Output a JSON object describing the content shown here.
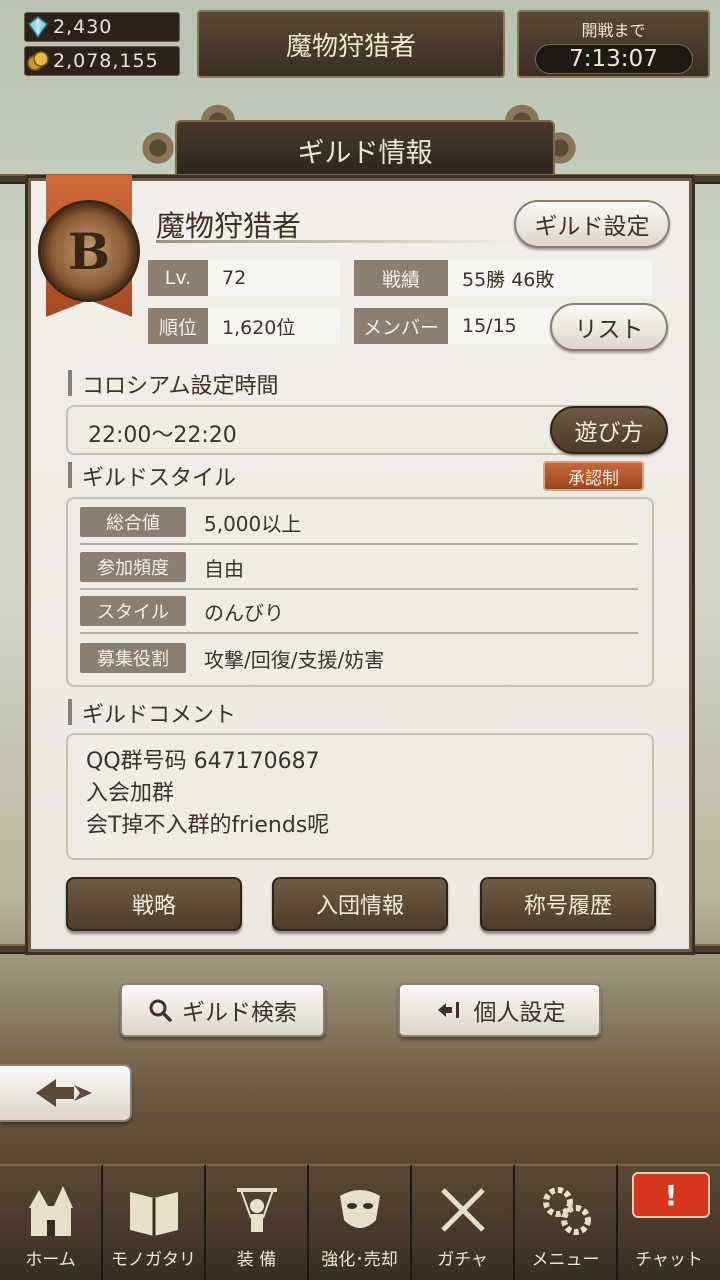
{
  "currency": {
    "gems": "2,430",
    "coins": "2,078,155"
  },
  "header": {
    "guild_title": "魔物狩猎者",
    "timer_label": "開戦まで",
    "timer_value": "7:13:07"
  },
  "panel": {
    "title": "ギルド情報"
  },
  "guild": {
    "rank": "B",
    "name": "魔物狩猎者",
    "settings_button": "ギルド設定",
    "level_label": "Lv.",
    "level_value": "72",
    "record_label": "戦績",
    "record_value": "55勝 46敗",
    "rank_label": "順位",
    "rank_value": "1,620位",
    "members_label": "メンバー",
    "members_value": "15/15",
    "list_button": "リスト"
  },
  "colosseum": {
    "title": "コロシアム設定時間",
    "time": "22:00〜22:20",
    "howto_button": "遊び方"
  },
  "style": {
    "title": "ギルドスタイル",
    "approval": "承認制",
    "rows": [
      {
        "label": "総合値",
        "value": "5,000以上"
      },
      {
        "label": "参加頻度",
        "value": "自由"
      },
      {
        "label": "スタイル",
        "value": "のんびり"
      },
      {
        "label": "募集役割",
        "value": "攻撃/回復/支援/妨害"
      }
    ]
  },
  "comment": {
    "title": "ギルドコメント",
    "lines": [
      "QQ群号码 647170687",
      "入会加群",
      "会T掉不入群的friends呢"
    ]
  },
  "actions": {
    "strategy": "戦略",
    "join_info": "入団情報",
    "title_history": "称号履歴"
  },
  "bottom": {
    "search": "ギルド検索",
    "personal": "個人設定"
  },
  "nav": {
    "items": [
      {
        "label": "ホーム",
        "icon": "castle-icon"
      },
      {
        "label": "モノガタリ",
        "icon": "book-icon"
      },
      {
        "label": "装 備",
        "icon": "puppet-icon"
      },
      {
        "label": "強化･売却",
        "icon": "mask-icon"
      },
      {
        "label": "ガチャ",
        "icon": "swords-icon"
      },
      {
        "label": "メニュー",
        "icon": "gears-icon"
      },
      {
        "label": "チャット",
        "icon": "chat-icon"
      }
    ],
    "chat_badge": "!"
  }
}
